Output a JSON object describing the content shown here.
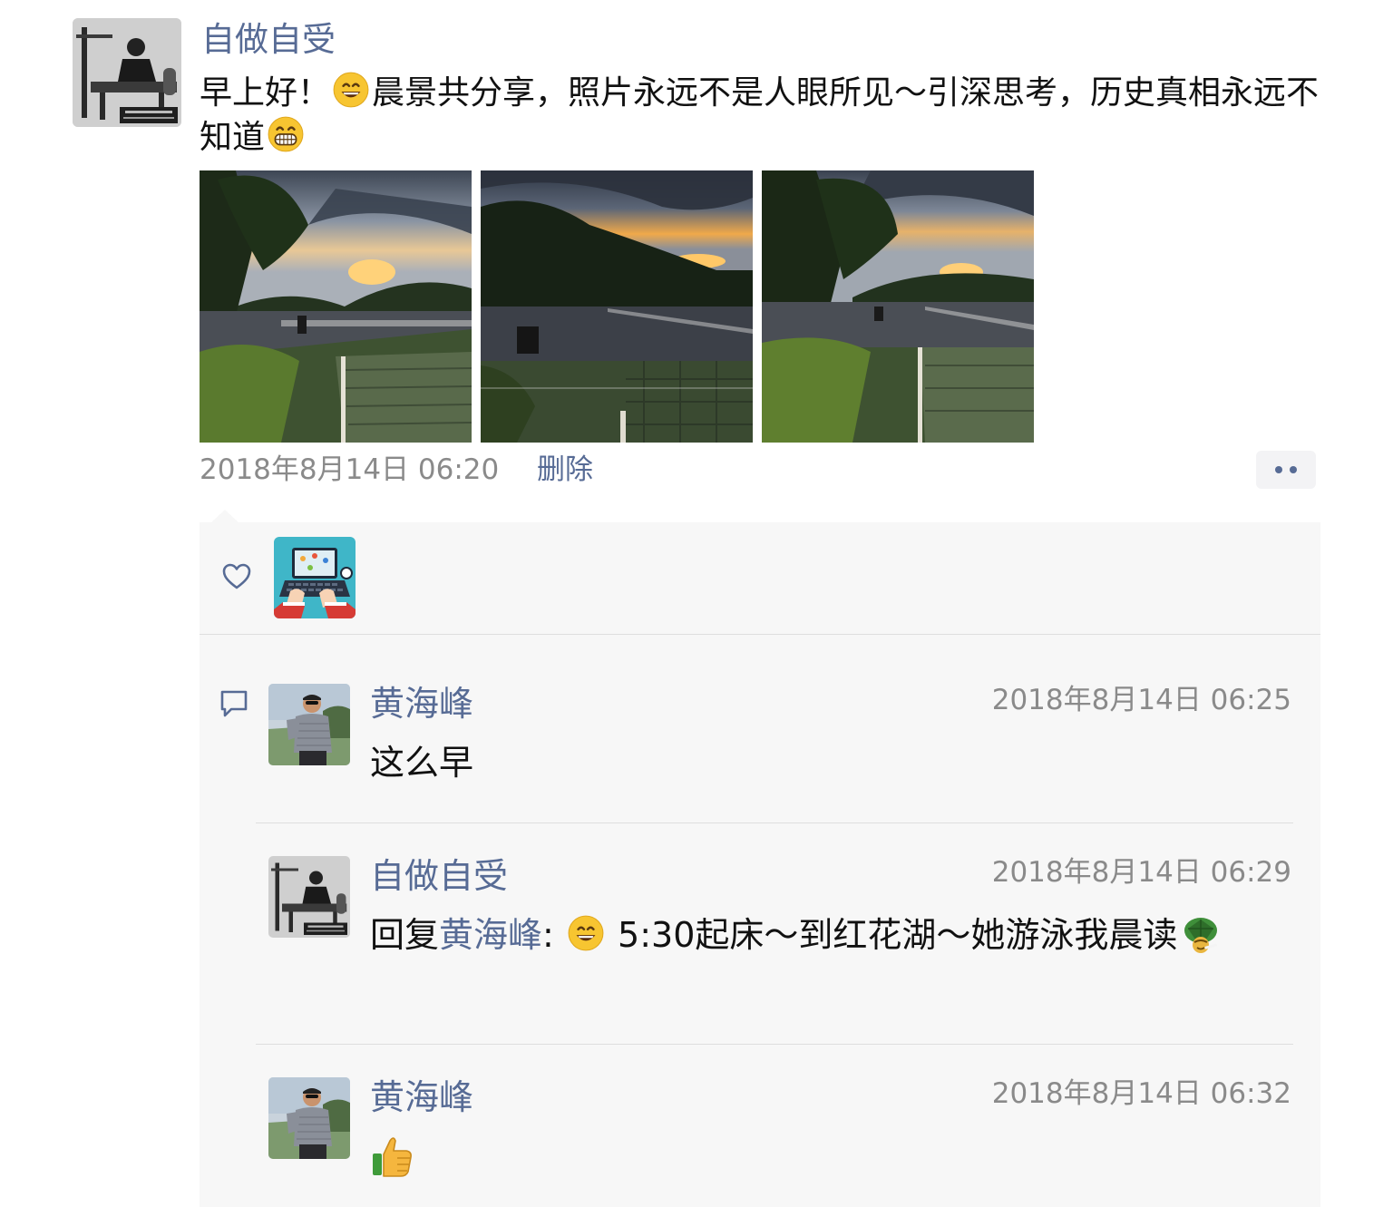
{
  "post": {
    "author": "自做自受",
    "text_part1": "早上好！",
    "emoji1": "grinning-face-emoji",
    "text_part2": "晨景共分享，照片永远不是人眼所见～引深思考，历史真相永远不知道",
    "emoji2": "grimacing-face-emoji",
    "photos": [
      {
        "name": "sunrise-road-photo-1"
      },
      {
        "name": "sunrise-road-photo-2"
      },
      {
        "name": "sunrise-road-photo-3"
      }
    ],
    "timestamp": "2018年8月14日 06:20",
    "delete_label": "删除",
    "more_icon": "more-dots-icon"
  },
  "likes": {
    "icon": "heart-outline-icon",
    "users": [
      {
        "avatar": "laptop-illustration-avatar"
      }
    ]
  },
  "comments": {
    "icon": "comment-bubble-icon",
    "items": [
      {
        "author": "黄海峰",
        "time": "2018年8月14日 06:25",
        "text": "这么早"
      },
      {
        "author": "自做自受",
        "time": "2018年8月14日 06:29",
        "reply_prefix": "回复",
        "reply_to": "黄海峰",
        "reply_colon": ":",
        "emoji": "grinning-face-emoji",
        "text": "5:30起床～到红花湖～她游泳我晨读",
        "trailing_emoji": "turtle-emoji"
      },
      {
        "author": "黄海峰",
        "time": "2018年8月14日 06:32",
        "emoji": "thumbs-up-emoji"
      }
    ]
  },
  "colors": {
    "link_blue": "#576b95",
    "meta_gray": "#8a8a8a",
    "panel_bg": "#f7f7f7"
  }
}
